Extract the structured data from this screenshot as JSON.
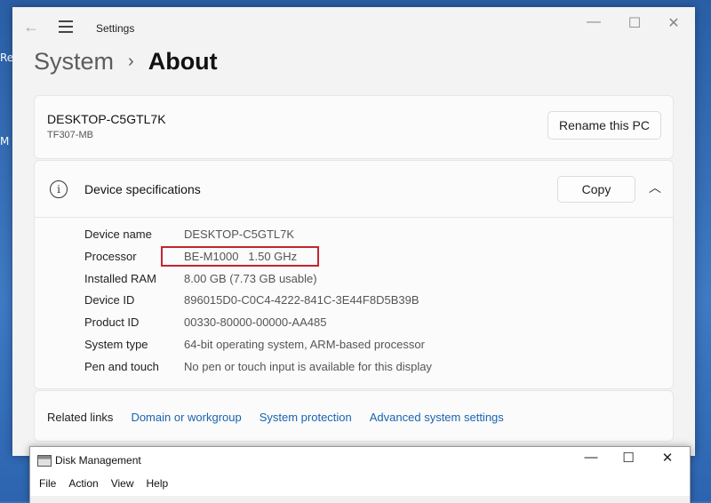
{
  "desktop": {
    "fragments": [
      "Re",
      "M"
    ]
  },
  "settings": {
    "app_title": "Settings",
    "breadcrumb": {
      "parent": "System",
      "separator": "›",
      "current": "About"
    },
    "device": {
      "name": "DESKTOP-C5GTL7K",
      "model": "TF307-MB",
      "rename_button": "Rename this PC"
    },
    "specs": {
      "title": "Device specifications",
      "copy_button": "Copy",
      "rows": [
        {
          "label": "Device name",
          "value": "DESKTOP-C5GTL7K"
        },
        {
          "label": "Processor",
          "value": "BE-M1000   1.50 GHz"
        },
        {
          "label": "Installed RAM",
          "value": "8.00 GB (7.73 GB usable)"
        },
        {
          "label": "Device ID",
          "value": "896015D0-C0C4-4222-841C-3E44F8D5B39B"
        },
        {
          "label": "Product ID",
          "value": "00330-80000-00000-AA485"
        },
        {
          "label": "System type",
          "value": "64-bit operating system, ARM-based processor"
        },
        {
          "label": "Pen and touch",
          "value": "No pen or touch input is available for this display"
        }
      ]
    },
    "related": {
      "label": "Related links",
      "links": [
        "Domain or workgroup",
        "System protection",
        "Advanced system settings"
      ]
    },
    "colors": {
      "highlight_box": "#c0272d",
      "link": "#1a63b0"
    }
  },
  "disk_management": {
    "title": "Disk Management",
    "menu": [
      "File",
      "Action",
      "View",
      "Help"
    ]
  }
}
